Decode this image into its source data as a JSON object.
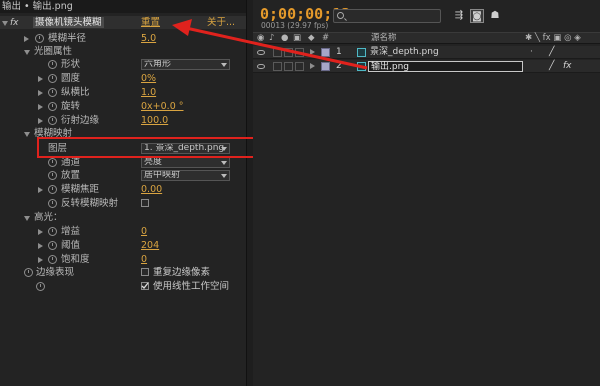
{
  "effect_controls": {
    "header": "输出 • 输出.png",
    "effect": {
      "badge": "fx",
      "name": "摄像机镜头模糊",
      "reset": "重置",
      "about": "关于..."
    },
    "rows": [
      {
        "label": "模糊半径",
        "value": "5.0"
      },
      {
        "label": "光圈属性"
      },
      {
        "label": "形状",
        "value": "六角形"
      },
      {
        "label": "圆度",
        "value": "0%"
      },
      {
        "label": "纵横比",
        "value": "1.0"
      },
      {
        "label": "旋转",
        "value": "0x+0.0 °"
      },
      {
        "label": "衍射边缘",
        "value": "100.0"
      },
      {
        "label": "模糊映射"
      },
      {
        "label": "图层",
        "value": "1. 景深_depth.png"
      },
      {
        "label": "通道",
        "value": "亮度"
      },
      {
        "label": "放置",
        "value": "居中映射"
      },
      {
        "label": "模糊焦距",
        "value": "0.00"
      },
      {
        "label": "反转模糊映射"
      },
      {
        "label": "高光："
      },
      {
        "label": "增益",
        "value": "0"
      },
      {
        "label": "阈值",
        "value": "204"
      },
      {
        "label": "饱和度",
        "value": "0"
      },
      {
        "label": "边缘表现",
        "checkbox_label": "重复边缘像素"
      },
      {
        "checkbox_label": "使用线性工作空间",
        "checked": true
      }
    ]
  },
  "timeline": {
    "timecode": "0;00;00;13",
    "fps_info": "00013 (29.97 fps)",
    "search": {
      "value": ""
    },
    "columns": {
      "number": "#",
      "source_name": "源名称"
    },
    "layers": [
      {
        "number": "1",
        "name": "景深_depth.png"
      },
      {
        "number": "2",
        "name": "输出.png",
        "editing": true
      }
    ]
  },
  "colors": {
    "value_orange": "#d9a441",
    "timecode_orange": "#e59a2b",
    "highlight_red": "#e0221d",
    "arrow_red": "#e0221d"
  }
}
